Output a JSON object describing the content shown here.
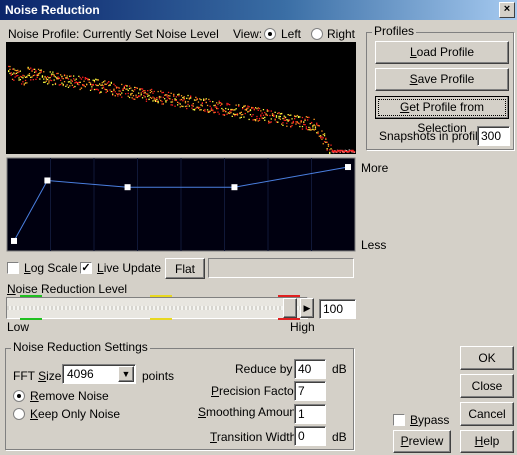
{
  "window": {
    "title": "Noise Reduction",
    "close_glyph": "×"
  },
  "profile_header": {
    "label": "Noise Profile: Currently Set Noise Level",
    "view_label": "View:",
    "left_label": "Left",
    "right_label": "Right",
    "selected_view": "Left"
  },
  "profiles": {
    "group_label": "Profiles",
    "load_label": "Load Profile",
    "save_label": "Save Profile",
    "get_label": "Get Profile from Selection",
    "snapshots_label": "Snapshots in profile",
    "snapshots_value": "300"
  },
  "graph": {
    "more_label": "More",
    "less_label": "Less",
    "points": [
      [
        0,
        0.06
      ],
      [
        0.1,
        0.78
      ],
      [
        0.34,
        0.7
      ],
      [
        0.66,
        0.7
      ],
      [
        1,
        0.94
      ]
    ],
    "colors": {
      "line": "#4a7fe0",
      "background": "#000010",
      "handle": "#ffffff"
    }
  },
  "options": {
    "log_scale_label": "Log Scale",
    "log_scale_checked": false,
    "live_update_label": "Live Update",
    "live_update_checked": true,
    "flat_label": "Flat"
  },
  "reduction_level": {
    "label": "Noise Reduction Level",
    "low_label": "Low",
    "high_label": "High",
    "value": "100",
    "level": 1.0
  },
  "settings": {
    "group_label": "Noise Reduction Settings",
    "fft_label": "FFT Size",
    "fft_value": "4096",
    "fft_unit": "points",
    "remove_noise_label": "Remove Noise",
    "keep_noise_label": "Keep Only Noise",
    "selected_mode": "Remove Noise",
    "reduce_by_label": "Reduce by",
    "reduce_by_value": "40",
    "reduce_by_unit": "dB",
    "precision_label": "Precision Factor",
    "precision_value": "7",
    "smoothing_label": "Smoothing Amount",
    "smoothing_value": "1",
    "transition_label": "Transition Width",
    "transition_value": "0",
    "transition_unit": "dB"
  },
  "actions": {
    "ok_label": "OK",
    "close_label": "Close",
    "cancel_label": "Cancel",
    "bypass_label": "Bypass",
    "bypass_checked": false,
    "preview_label": "Preview",
    "help_label": "Help"
  },
  "spectrum_colors": {
    "red": "#ff2020",
    "yellow": "#ffff40",
    "orange": "#ff9a20",
    "white": "#ffffff"
  }
}
